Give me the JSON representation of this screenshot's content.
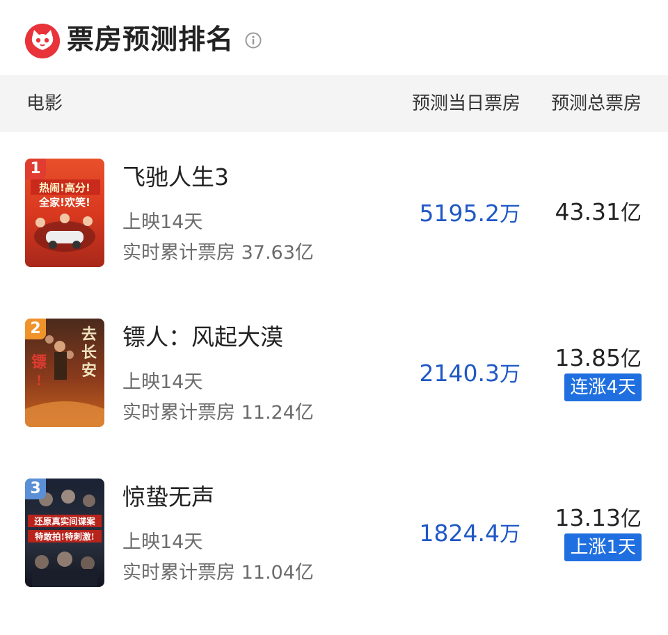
{
  "header": {
    "title": "票房预测排名",
    "logo_icon": "cat-logo-icon",
    "info_icon": "info-icon",
    "brand_color": "#e8333a"
  },
  "columns": {
    "movie": "电影",
    "day_forecast": "预测当日票房",
    "total_forecast": "预测总票房"
  },
  "movies": [
    {
      "rank": "1",
      "rank_color": "#e03c31",
      "title": "飞驰人生3",
      "days": "上映14天",
      "realtime_box": "实时累计票房 37.63亿",
      "day_value": "5195.2",
      "day_unit": "万",
      "total_value": "43.31",
      "total_unit": "亿",
      "tag": "",
      "poster_text": "热闹!高分!全家!欢笑!"
    },
    {
      "rank": "2",
      "rank_color": "#f0932b",
      "title": "镖人：风起大漠",
      "days": "上映14天",
      "realtime_box": "实时累计票房 11.24亿",
      "day_value": "2140.3",
      "day_unit": "万",
      "total_value": "13.85",
      "total_unit": "亿",
      "tag": "连涨4天",
      "poster_text": "去长安 镖!"
    },
    {
      "rank": "3",
      "rank_color": "#5b8fd6",
      "title": "惊蛰无声",
      "days": "上映14天",
      "realtime_box": "实时累计票房 11.04亿",
      "day_value": "1824.4",
      "day_unit": "万",
      "total_value": "13.13",
      "total_unit": "亿",
      "tag": "上涨1天",
      "poster_text": "还原真实间谍案 特敢拍!特刺激!"
    }
  ],
  "accent_color": "#1f58c6",
  "tag_color": "#1f6fe0"
}
